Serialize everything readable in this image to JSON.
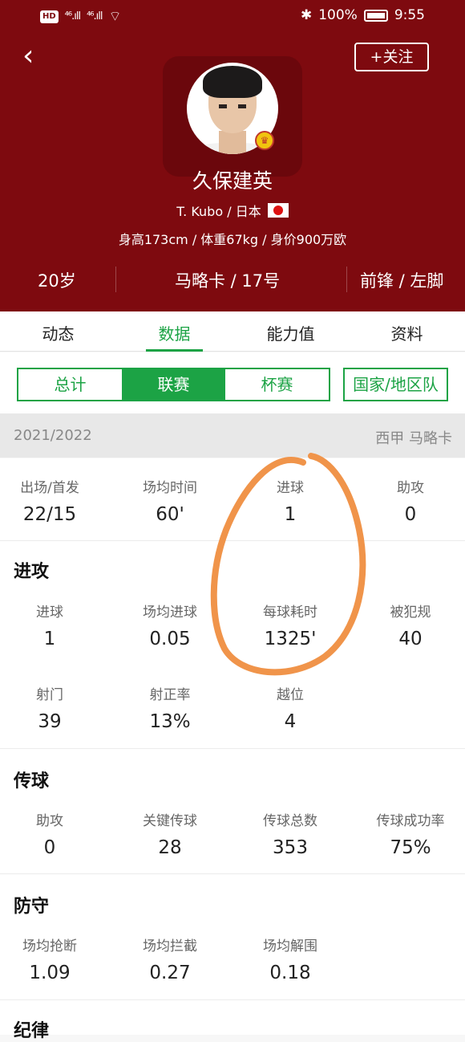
{
  "status_bar": {
    "hd": "HD",
    "sig1": "⁴⁶.ıll",
    "sig2": "⁴⁶.ıll",
    "battery": "100%",
    "time": "9:55"
  },
  "header": {
    "back": "‹",
    "follow": "+关注",
    "name": "久保建英",
    "latin_name": "T. Kubo / 日本",
    "bio": "身高173cm / 体重67kg / 身价900万欧",
    "age": "20岁",
    "club_number": "马略卡 / 17号",
    "position_foot": "前锋 / 左脚",
    "accent": "#7e0a0f"
  },
  "tabs": [
    "动态",
    "数据",
    "能力值",
    "资料"
  ],
  "segments": [
    "总计",
    "联赛",
    "杯赛"
  ],
  "national_team": "国家/地区队",
  "season": {
    "year": "2021/2022",
    "league": "西甲 马略卡"
  },
  "summary": [
    {
      "label": "出场/首发",
      "value": "22/15"
    },
    {
      "label": "场均时间",
      "value": "60'"
    },
    {
      "label": "进球",
      "value": "1"
    },
    {
      "label": "助攻",
      "value": "0"
    }
  ],
  "attack": {
    "title": "进攻",
    "row1": [
      {
        "label": "进球",
        "value": "1"
      },
      {
        "label": "场均进球",
        "value": "0.05"
      },
      {
        "label": "每球耗时",
        "value": "1325'"
      },
      {
        "label": "被犯规",
        "value": "40"
      }
    ],
    "row2": [
      {
        "label": "射门",
        "value": "39"
      },
      {
        "label": "射正率",
        "value": "13%"
      },
      {
        "label": "越位",
        "value": "4"
      }
    ]
  },
  "passing": {
    "title": "传球",
    "row1": [
      {
        "label": "助攻",
        "value": "0"
      },
      {
        "label": "关键传球",
        "value": "28"
      },
      {
        "label": "传球总数",
        "value": "353"
      },
      {
        "label": "传球成功率",
        "value": "75%"
      }
    ]
  },
  "defense": {
    "title": "防守",
    "row1": [
      {
        "label": "场均抢断",
        "value": "1.09"
      },
      {
        "label": "场均拦截",
        "value": "0.27"
      },
      {
        "label": "场均解围",
        "value": "0.18"
      }
    ]
  },
  "discipline": {
    "title": "纪律"
  },
  "colors": {
    "green": "#1ca345",
    "annotation": "#f0944a"
  }
}
